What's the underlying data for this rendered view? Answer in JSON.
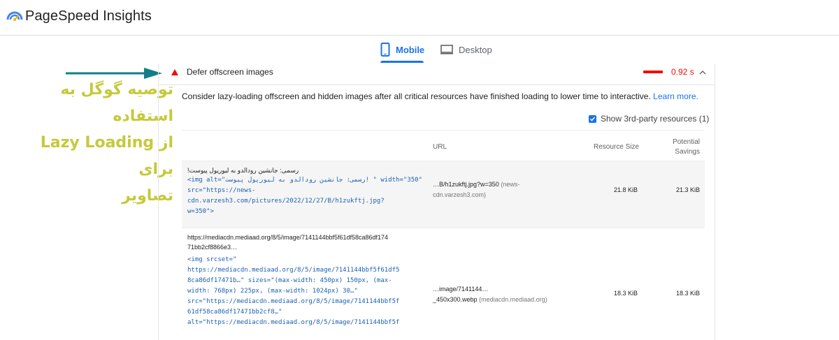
{
  "app": {
    "title": "PageSpeed Insights"
  },
  "tabs": [
    {
      "label": "Mobile",
      "active": true
    },
    {
      "label": "Desktop",
      "active": false
    }
  ],
  "annotation": {
    "line1": "توصیه گوگل به استفاده",
    "line2": "از Lazy Loading برای",
    "line3": "تصاویر",
    "color": "#c6c93a",
    "arrow_color": "#127f86"
  },
  "audit": {
    "title": "Defer offscreen images",
    "savings": "0.92 s",
    "status_color": "#eb0f00",
    "description": "Consider lazy-loading offscreen and hidden images after all critical resources have finished loading to lower time to interactive.",
    "learn_more": "Learn more.",
    "third_party_label": "Show 3rd-party resources (1)",
    "third_party_checked": true
  },
  "table": {
    "headers": {
      "url": "URL",
      "size": "Resource Size",
      "savings_line1": "Potential",
      "savings_line2": "Savings"
    },
    "rows": [
      {
        "node_label": "رسمی: جانشین رودالدو به لیورپول پیوست!",
        "code": "<img alt=\"رسمی: جانشین رودالدو به لیورپول پیوست! \" width=\"350\"\nsrc=\"https://news-\ncdn.varzesh3.com/pictures/2022/12/27/B/h1zukftj.jpg?\nw=350\">",
        "url_main": "…B/h1zukftj.jpg?w=350",
        "url_host": "(news-",
        "url_host2": "cdn.varzesh3.com)",
        "size": "21.8 KiB",
        "savings": "21.3 KiB"
      },
      {
        "node_label": "https://mediacdn.mediaad.org/8/5/image/7141144bbf5f61df58ca86df174\n71bb2cf8866e3…",
        "code": "<img srcset=\"\nhttps://mediacdn.mediaad.org/8/5/image/7141144bbf5f61df5\n8ca86df17471b…\" sizes=\"(max-width: 450px) 150px, (max-\nwidth: 768px) 225px, (max-width: 1024px) 30…\"\nsrc=\"https://mediacdn.mediaad.org/8/5/image/7141144bbf5f\n61df58ca86df17471bb2cf8…\"\nalt=\"https://mediacdn.mediaad.org/8/5/image/7141144bbf5f",
        "url_main": "…image/7141144…",
        "url_main2": "_450x300.webp",
        "url_host": "(mediacdn.mediaad.org)",
        "size": "18.3 KiB",
        "savings": "18.3 KiB"
      }
    ]
  }
}
